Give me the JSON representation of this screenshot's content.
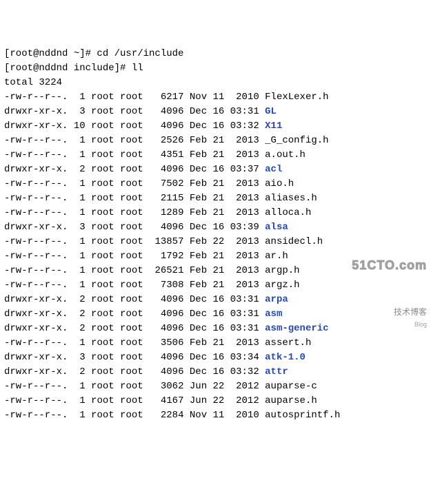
{
  "prompts": {
    "line1_prefix": "[root@nddnd ~]# ",
    "line1_cmd": "cd /usr/include",
    "line2_prefix": "[root@nddnd include]# ",
    "line2_cmd": "ll"
  },
  "total_line": "total 3224",
  "rows": [
    {
      "perm": "-rw-r--r--.",
      "links": " 1",
      "own": "root",
      "grp": "root",
      "size": "  6217",
      "m": "Nov",
      "d": "11",
      "t": " 2010",
      "name": "FlexLexer.h",
      "dir": false
    },
    {
      "perm": "drwxr-xr-x.",
      "links": " 3",
      "own": "root",
      "grp": "root",
      "size": "  4096",
      "m": "Dec",
      "d": "16",
      "t": "03:31",
      "name": "GL",
      "dir": true
    },
    {
      "perm": "drwxr-xr-x.",
      "links": "10",
      "own": "root",
      "grp": "root",
      "size": "  4096",
      "m": "Dec",
      "d": "16",
      "t": "03:32",
      "name": "X11",
      "dir": true
    },
    {
      "perm": "-rw-r--r--.",
      "links": " 1",
      "own": "root",
      "grp": "root",
      "size": "  2526",
      "m": "Feb",
      "d": "21",
      "t": " 2013",
      "name": "_G_config.h",
      "dir": false
    },
    {
      "perm": "-rw-r--r--.",
      "links": " 1",
      "own": "root",
      "grp": "root",
      "size": "  4351",
      "m": "Feb",
      "d": "21",
      "t": " 2013",
      "name": "a.out.h",
      "dir": false
    },
    {
      "perm": "drwxr-xr-x.",
      "links": " 2",
      "own": "root",
      "grp": "root",
      "size": "  4096",
      "m": "Dec",
      "d": "16",
      "t": "03:37",
      "name": "acl",
      "dir": true
    },
    {
      "perm": "-rw-r--r--.",
      "links": " 1",
      "own": "root",
      "grp": "root",
      "size": "  7502",
      "m": "Feb",
      "d": "21",
      "t": " 2013",
      "name": "aio.h",
      "dir": false
    },
    {
      "perm": "-rw-r--r--.",
      "links": " 1",
      "own": "root",
      "grp": "root",
      "size": "  2115",
      "m": "Feb",
      "d": "21",
      "t": " 2013",
      "name": "aliases.h",
      "dir": false
    },
    {
      "perm": "-rw-r--r--.",
      "links": " 1",
      "own": "root",
      "grp": "root",
      "size": "  1289",
      "m": "Feb",
      "d": "21",
      "t": " 2013",
      "name": "alloca.h",
      "dir": false
    },
    {
      "perm": "drwxr-xr-x.",
      "links": " 3",
      "own": "root",
      "grp": "root",
      "size": "  4096",
      "m": "Dec",
      "d": "16",
      "t": "03:39",
      "name": "alsa",
      "dir": true
    },
    {
      "perm": "-rw-r--r--.",
      "links": " 1",
      "own": "root",
      "grp": "root",
      "size": " 13857",
      "m": "Feb",
      "d": "22",
      "t": " 2013",
      "name": "ansidecl.h",
      "dir": false
    },
    {
      "perm": "-rw-r--r--.",
      "links": " 1",
      "own": "root",
      "grp": "root",
      "size": "  1792",
      "m": "Feb",
      "d": "21",
      "t": " 2013",
      "name": "ar.h",
      "dir": false
    },
    {
      "perm": "-rw-r--r--.",
      "links": " 1",
      "own": "root",
      "grp": "root",
      "size": " 26521",
      "m": "Feb",
      "d": "21",
      "t": " 2013",
      "name": "argp.h",
      "dir": false
    },
    {
      "perm": "-rw-r--r--.",
      "links": " 1",
      "own": "root",
      "grp": "root",
      "size": "  7308",
      "m": "Feb",
      "d": "21",
      "t": " 2013",
      "name": "argz.h",
      "dir": false
    },
    {
      "perm": "drwxr-xr-x.",
      "links": " 2",
      "own": "root",
      "grp": "root",
      "size": "  4096",
      "m": "Dec",
      "d": "16",
      "t": "03:31",
      "name": "arpa",
      "dir": true
    },
    {
      "perm": "drwxr-xr-x.",
      "links": " 2",
      "own": "root",
      "grp": "root",
      "size": "  4096",
      "m": "Dec",
      "d": "16",
      "t": "03:31",
      "name": "asm",
      "dir": true
    },
    {
      "perm": "drwxr-xr-x.",
      "links": " 2",
      "own": "root",
      "grp": "root",
      "size": "  4096",
      "m": "Dec",
      "d": "16",
      "t": "03:31",
      "name": "asm-generic",
      "dir": true
    },
    {
      "perm": "-rw-r--r--.",
      "links": " 1",
      "own": "root",
      "grp": "root",
      "size": "  3506",
      "m": "Feb",
      "d": "21",
      "t": " 2013",
      "name": "assert.h",
      "dir": false
    },
    {
      "perm": "drwxr-xr-x.",
      "links": " 3",
      "own": "root",
      "grp": "root",
      "size": "  4096",
      "m": "Dec",
      "d": "16",
      "t": "03:34",
      "name": "atk-1.0",
      "dir": true
    },
    {
      "perm": "drwxr-xr-x.",
      "links": " 2",
      "own": "root",
      "grp": "root",
      "size": "  4096",
      "m": "Dec",
      "d": "16",
      "t": "03:32",
      "name": "attr",
      "dir": true
    },
    {
      "perm": "-rw-r--r--.",
      "links": " 1",
      "own": "root",
      "grp": "root",
      "size": "  3062",
      "m": "Jun",
      "d": "22",
      "t": " 2012",
      "name": "auparse-c",
      "dir": false
    },
    {
      "perm": "-rw-r--r--.",
      "links": " 1",
      "own": "root",
      "grp": "root",
      "size": "  4167",
      "m": "Jun",
      "d": "22",
      "t": " 2012",
      "name": "auparse.h",
      "dir": false
    },
    {
      "perm": "-rw-r--r--.",
      "links": " 1",
      "own": "root",
      "grp": "root",
      "size": "  2284",
      "m": "Nov",
      "d": "11",
      "t": " 2010",
      "name": "autosprintf.h",
      "dir": false
    }
  ],
  "watermark": {
    "site": "51CTO.com",
    "sub": "技术博客",
    "blog": "Blog"
  }
}
